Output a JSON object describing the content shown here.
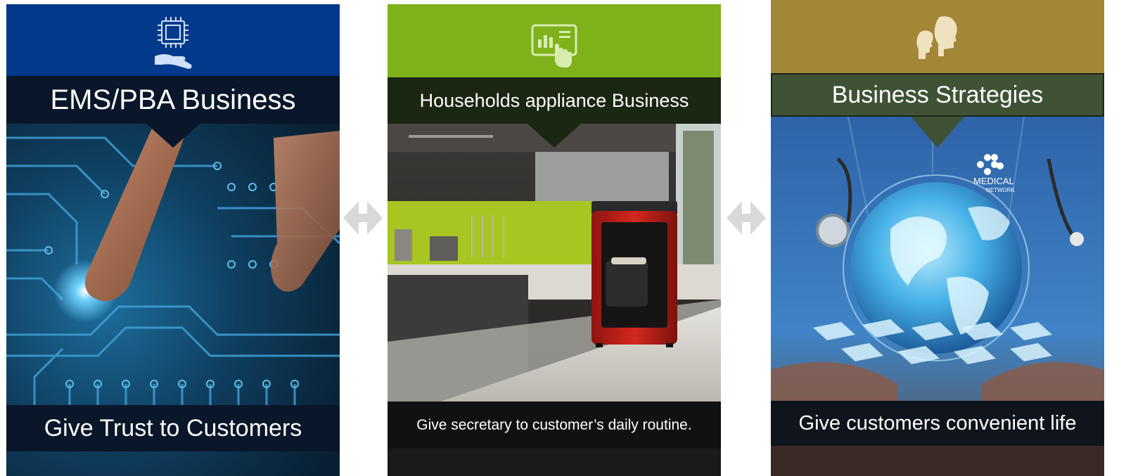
{
  "panels": [
    {
      "title": "EMS/PBA Business",
      "subtitle": "Give Trust to Customers",
      "icon": "chip-in-hand-icon",
      "header_color": "#02398a",
      "title_bar_color": "#0a1629"
    },
    {
      "title": "Households appliance Business",
      "subtitle": "Give secretary to customer’s daily routine.",
      "icon": "tablet-touch-icon",
      "header_color": "#7fb11a",
      "title_bar_color": "#1b2613"
    },
    {
      "title": "Business Strategies",
      "subtitle": "Give customers convenient life",
      "icon": "two-heads-talking-icon",
      "header_color": "#a38636",
      "title_bar_color": "#3f5236"
    }
  ],
  "connectors": [
    "double-arrow-icon",
    "double-arrow-icon"
  ],
  "overlay_text": {
    "network_label_line1": "MEDICAL",
    "network_label_line2": "NETWORK"
  }
}
